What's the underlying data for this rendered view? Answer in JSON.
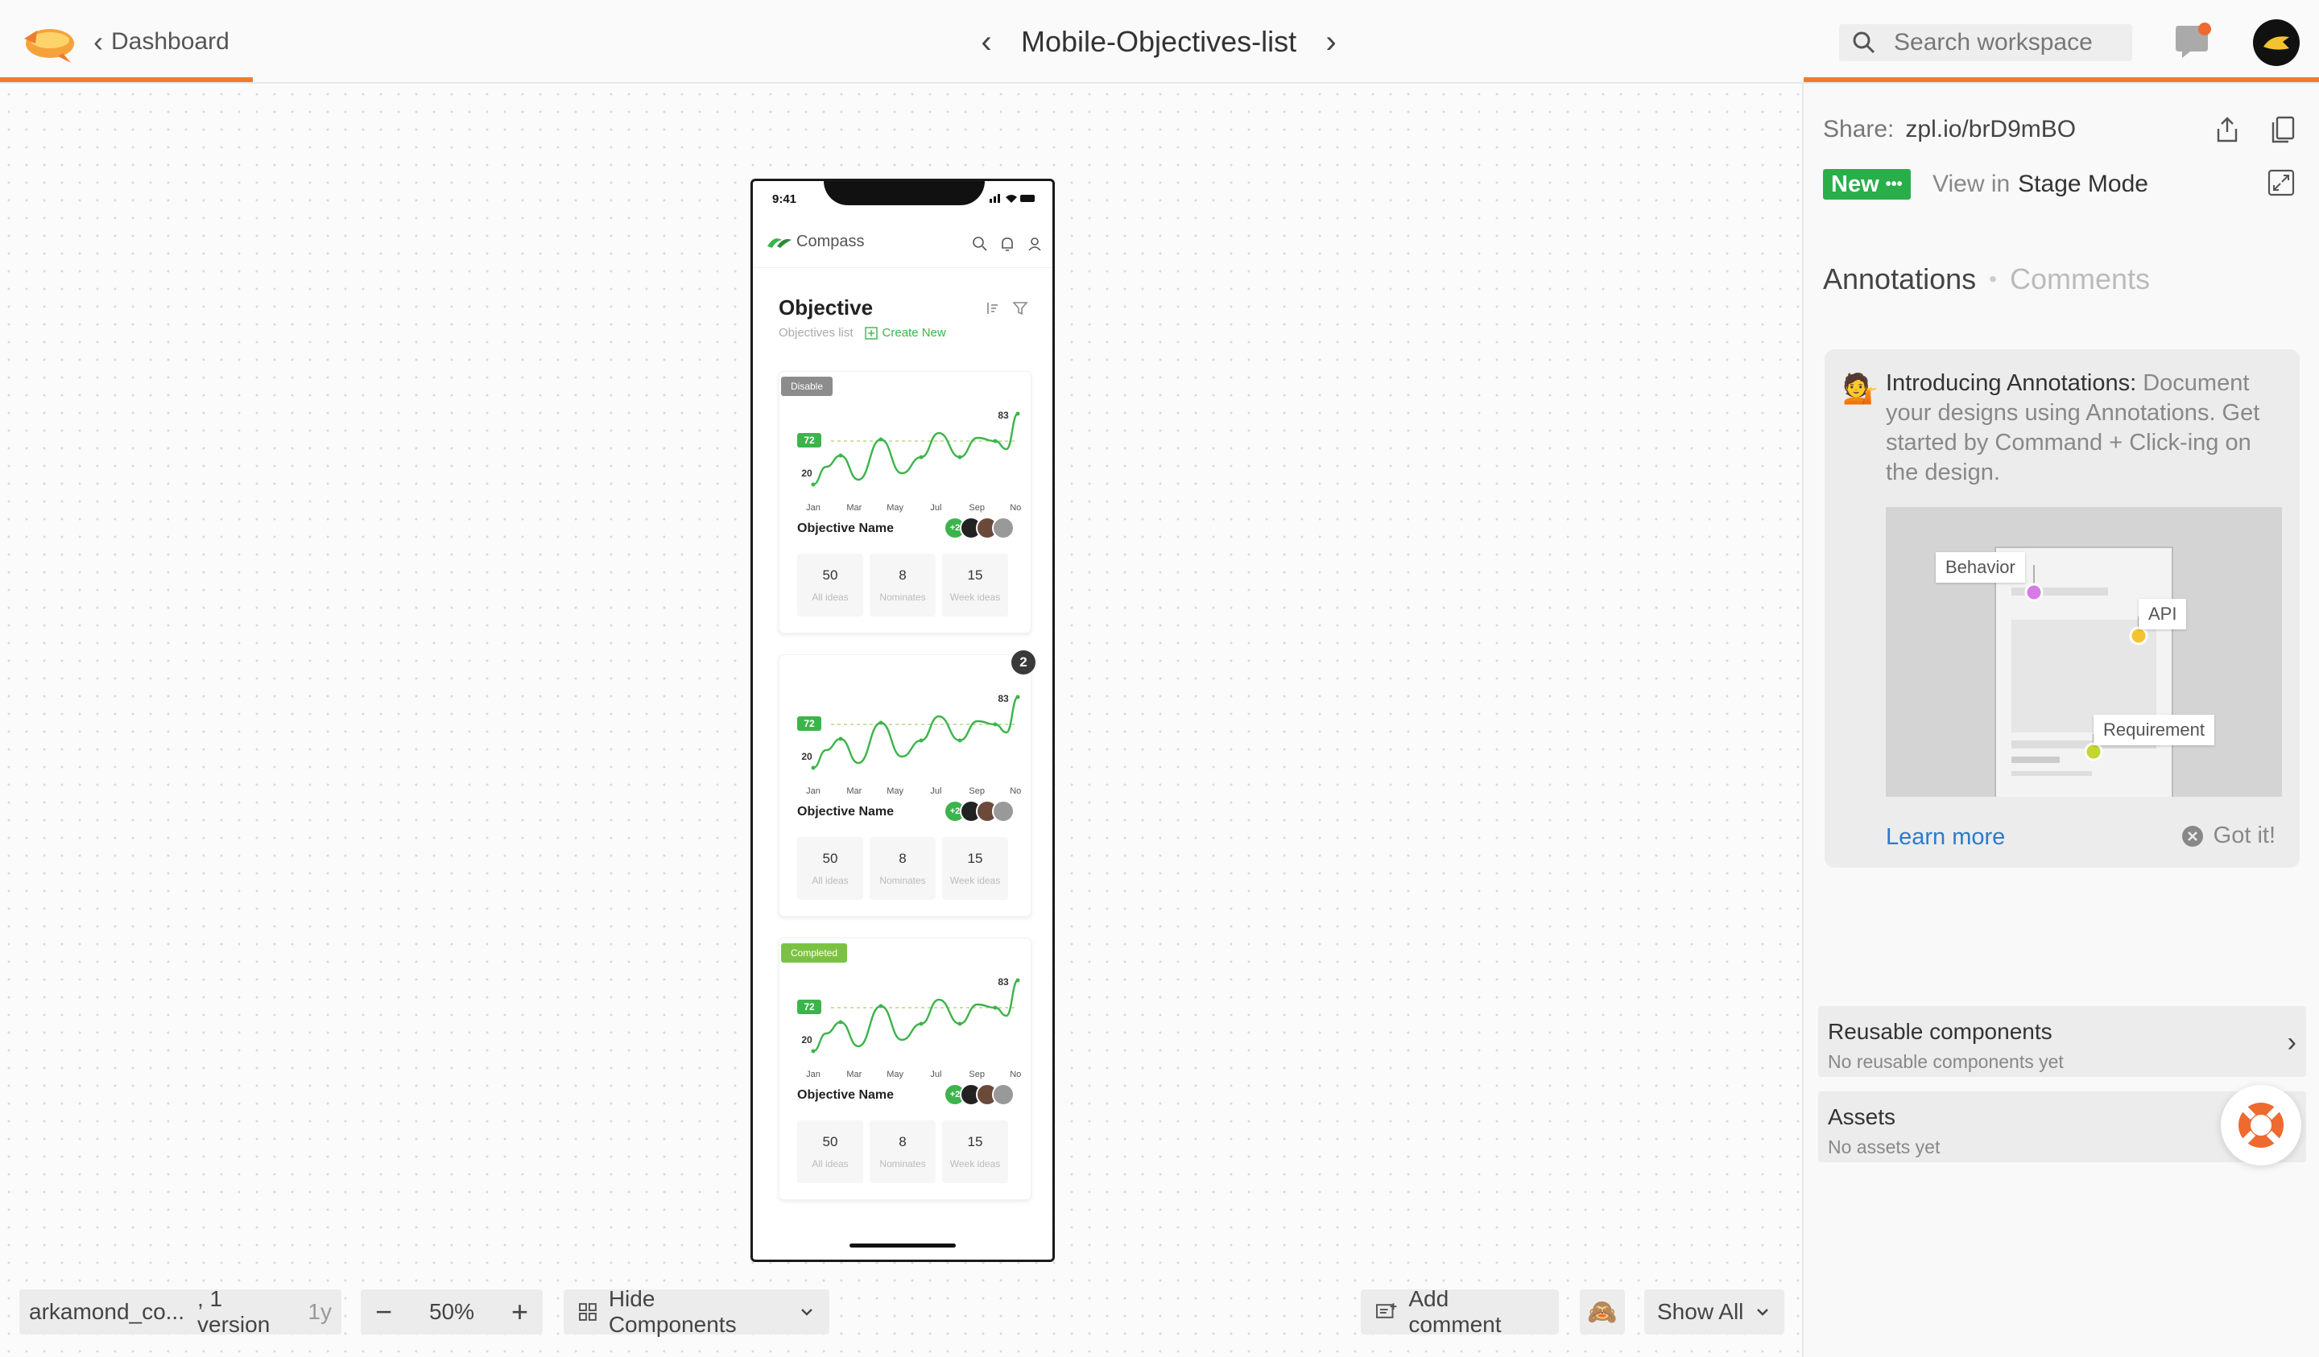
{
  "topbar": {
    "back_label": "Dashboard",
    "screen_name": "Mobile-Objectives-list",
    "search_placeholder": "Search workspace"
  },
  "phone": {
    "status_time": "9:41",
    "app_name": "Compass",
    "page_heading": "Objective",
    "page_sub": "Objectives list",
    "create_new": "Create New",
    "comment_count": "2",
    "cards": [
      {
        "badge": "Disable",
        "badge_color": "#8c8c8c",
        "name": "Objective Name",
        "more": "+2",
        "stats": [
          {
            "num": "50",
            "lbl": "All ideas"
          },
          {
            "num": "8",
            "lbl": "Nominates"
          },
          {
            "num": "15",
            "lbl": "Week ideas"
          }
        ]
      },
      {
        "badge": "",
        "badge_color": "",
        "name": "Objective Name",
        "more": "+2",
        "stats": [
          {
            "num": "50",
            "lbl": "All ideas"
          },
          {
            "num": "8",
            "lbl": "Nominates"
          },
          {
            "num": "15",
            "lbl": "Week ideas"
          }
        ]
      },
      {
        "badge": "Completed",
        "badge_color": "#7cc242",
        "name": "Objective Name",
        "more": "+2",
        "stats": [
          {
            "num": "50",
            "lbl": "All ideas"
          },
          {
            "num": "8",
            "lbl": "Nominates"
          },
          {
            "num": "15",
            "lbl": "Week ideas"
          }
        ]
      }
    ],
    "chart": {
      "months": [
        "Jan",
        "Mar",
        "May",
        "Jul",
        "Sep",
        "Nov"
      ],
      "marker_value": "72",
      "min_label": "20",
      "max_label": "83",
      "line_color": "#3cb44b"
    }
  },
  "toolbar": {
    "project": "arkamond_co...",
    "versions": ", 1 version",
    "age": "1y",
    "zoom": "50%",
    "hide_components": "Hide Components",
    "add_comment": "Add comment",
    "show_all": "Show All"
  },
  "panel": {
    "share_label": "Share:",
    "share_link": "zpl.io/brD9mBO",
    "new_badge": "New",
    "view_in": "View in",
    "stage_mode": "Stage Mode",
    "tab_annotations": "Annotations",
    "tab_comments": "Comments",
    "intro_title": "Introducing Annotations:",
    "intro_body": "Document your designs using Annotations. Get started by Command + Click-ing on the design.",
    "illus_behavior": "Behavior",
    "illus_api": "API",
    "illus_requirement": "Requirement",
    "learn_more": "Learn more",
    "got_it": "Got it!",
    "reusable_title": "Reusable components",
    "reusable_sub": "No reusable components yet",
    "assets_title": "Assets",
    "assets_sub": "No assets yet"
  },
  "colors": {
    "accent": "#ee7c2f",
    "green": "#2aae4a",
    "link": "#2b7bcb"
  }
}
